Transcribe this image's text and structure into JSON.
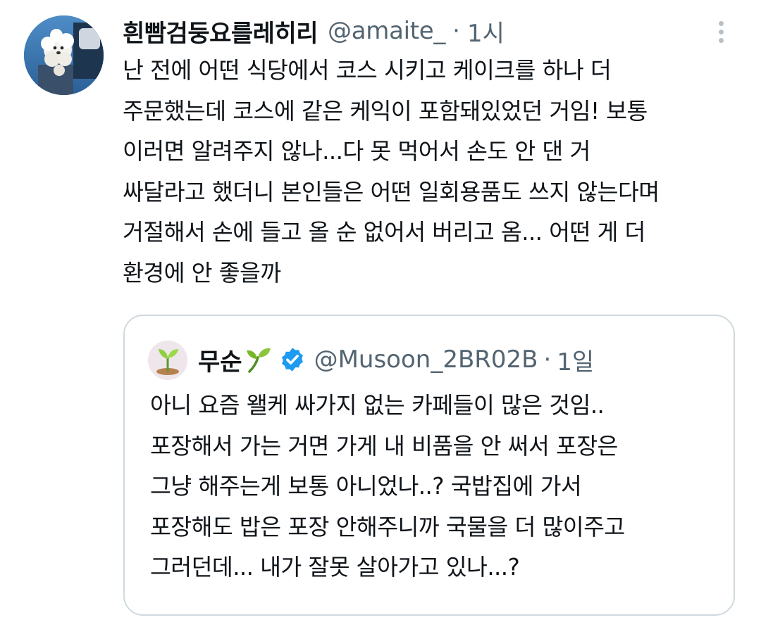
{
  "tweet": {
    "display_name": "흰빰검둥요를레히리",
    "handle": "@amaite_",
    "separator": "·",
    "time": "1시",
    "avatar_icon": "avatar-white-dog-photo",
    "more_icon": "more-vertical-icon",
    "lines": [
      "난 전에 어떤 식당에서 코스 시키고 케이크를 하나 더",
      "주문했는데 코스에 같은 케익이 포함돼있었던 거임! 보통",
      "이러면 알려주지 않나...다 못 먹어서 손도 안 댄 거",
      "싸달라고 했더니 본인들은 어떤 일회용품도 쓰지 않는다며",
      "거절해서 손에 들고 올 순 없어서 버리고 옴... 어떤 게 더",
      "환경에 안 좋을까"
    ]
  },
  "quoted_tweet": {
    "display_name": "무순",
    "name_emoji_icon": "seedling-icon",
    "verified_icon": "verified-badge-icon",
    "handle": "@Musoon_2BR02B",
    "separator": "·",
    "time": "1일",
    "avatar_icon": "avatar-seedling-icon",
    "lines": [
      "아니 요즘 왤케 싸가지 없는 카페들이 많은 것임..",
      "포장해서 가는 거면 가게 내 비품을 안 써서 포장은",
      "그냥 해주는게 보통 아니었나..? 국밥집에 가서",
      "포장해도 밥은 포장 안해주니까 국물을 더 많이주고",
      "그러던데... 내가 잘못 살아가고 있나...?"
    ]
  },
  "colors": {
    "text_primary": "#0f1419",
    "text_secondary": "#536471",
    "border": "#cfd9de",
    "verified_blue": "#1d9bf0"
  }
}
